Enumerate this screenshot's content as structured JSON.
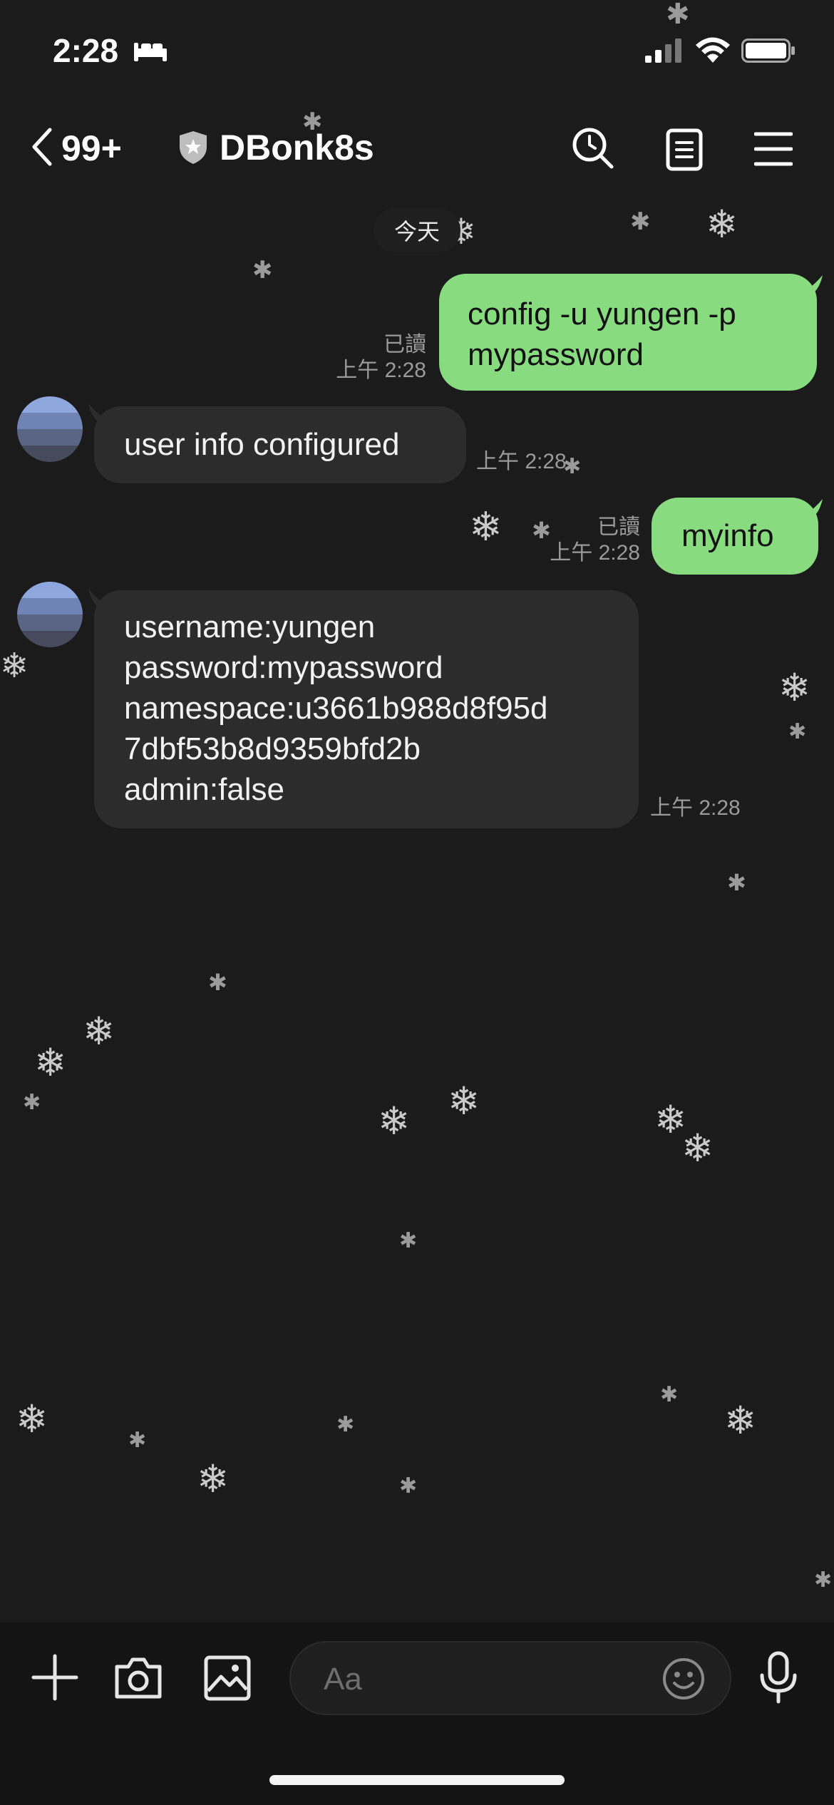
{
  "status_bar": {
    "time": "2:28",
    "icons": [
      "sleep-icon",
      "cellular-icon",
      "wifi-icon",
      "battery-icon"
    ]
  },
  "header": {
    "back_count": "99+",
    "title": "DBonk8s",
    "icons": [
      "back-icon",
      "shield-icon",
      "search-icon",
      "notes-icon",
      "menu-icon"
    ]
  },
  "date_label": "今天",
  "messages": [
    {
      "direction": "out",
      "text_lines": [
        "config -u yungen -p",
        "mypassword"
      ],
      "read_label": "已讀",
      "time": "上午 2:28"
    },
    {
      "direction": "in",
      "text_lines": [
        "user info configured"
      ],
      "time": "上午 2:28"
    },
    {
      "direction": "out",
      "text_lines": [
        "myinfo"
      ],
      "read_label": "已讀",
      "time": "上午 2:28"
    },
    {
      "direction": "in",
      "text_lines": [
        "username:yungen",
        "password:mypassword",
        "namespace:u3661b988d8f95d",
        "7dbf53b8d9359bfd2b",
        "admin:false"
      ],
      "time": "上午 2:28"
    }
  ],
  "input_bar": {
    "placeholder": "Aa",
    "icons": [
      "plus-icon",
      "camera-icon",
      "image-icon",
      "emoji-icon",
      "microphone-icon"
    ]
  },
  "colors": {
    "background": "#1b1b1b",
    "outgoing_bubble": "#88dc7f",
    "incoming_bubble": "#2c2c2c",
    "input_bar": "#141414"
  }
}
